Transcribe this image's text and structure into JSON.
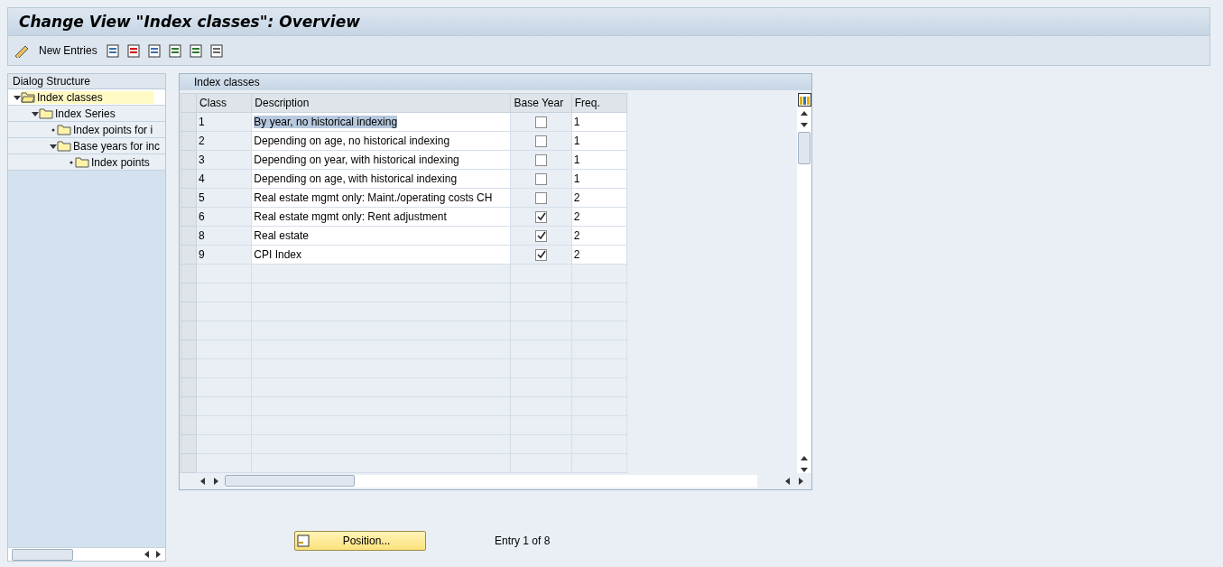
{
  "window": {
    "title": "Change View \"Index classes\": Overview"
  },
  "toolbar": {
    "new_entries": "New Entries"
  },
  "dialog_structure": {
    "title": "Dialog Structure",
    "items": [
      {
        "label": "Index classes",
        "selected": true,
        "expanded": true,
        "children": [
          {
            "label": "Index Series",
            "selected": false,
            "expanded": true,
            "children": [
              {
                "label": "Index points for i",
                "selected": false,
                "expanded": false
              },
              {
                "label": "Base years for inc",
                "selected": false,
                "expanded": true,
                "children": [
                  {
                    "label": "Index points",
                    "selected": false,
                    "expanded": false
                  }
                ]
              }
            ]
          }
        ]
      }
    ]
  },
  "table": {
    "title": "Index classes",
    "columns": [
      "Class",
      "Description",
      "Base Year",
      "Freq."
    ],
    "rows": [
      {
        "class": "1",
        "description": "By year, no historical indexing",
        "base_year": false,
        "freq": "1",
        "selected": true
      },
      {
        "class": "2",
        "description": "Depending on age, no historical indexing",
        "base_year": false,
        "freq": "1",
        "selected": false
      },
      {
        "class": "3",
        "description": "Depending on year, with historical indexing",
        "base_year": false,
        "freq": "1",
        "selected": false
      },
      {
        "class": "4",
        "description": "Depending on age, with historical indexing",
        "base_year": false,
        "freq": "1",
        "selected": false
      },
      {
        "class": "5",
        "description": "Real estate mgmt only: Maint./operating costs  CH",
        "base_year": false,
        "freq": "2",
        "selected": false
      },
      {
        "class": "6",
        "description": "Real estate mgmt only: Rent adjustment",
        "base_year": true,
        "freq": "2",
        "selected": false
      },
      {
        "class": "8",
        "description": "Real estate",
        "base_year": true,
        "freq": "2",
        "selected": false
      },
      {
        "class": "9",
        "description": "CPI Index",
        "base_year": true,
        "freq": "2",
        "selected": false
      }
    ]
  },
  "footer": {
    "position_button": "Position...",
    "entry_info": "Entry 1 of 8"
  }
}
